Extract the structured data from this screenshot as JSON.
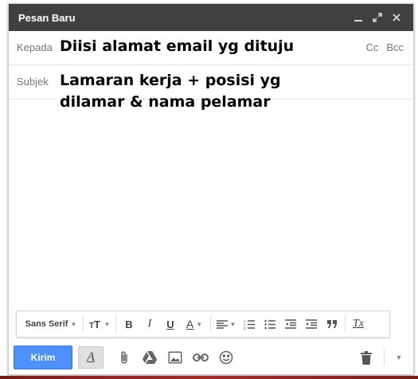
{
  "window": {
    "title": "Pesan Baru"
  },
  "fields": {
    "to_label": "Kepada",
    "to_value": "Diisi alamat email yg dituju",
    "cc": "Cc",
    "bcc": "Bcc",
    "subject_label": "Subjek",
    "subject_value_line1": "Lamaran kerja + posisi yg",
    "subject_value_line2": "dilamar & nama pelamar"
  },
  "format_toolbar": {
    "font_family": "Sans Serif",
    "size_icon": "text-size-icon",
    "bold": "B",
    "italic": "I",
    "underline": "U",
    "text_color": "A",
    "remove_format": "Tx"
  },
  "bottom_toolbar": {
    "send_label": "Kirim",
    "formatting_toggle": "A"
  },
  "colors": {
    "titlebar": "#404040",
    "send_button": "#4d90fe"
  }
}
